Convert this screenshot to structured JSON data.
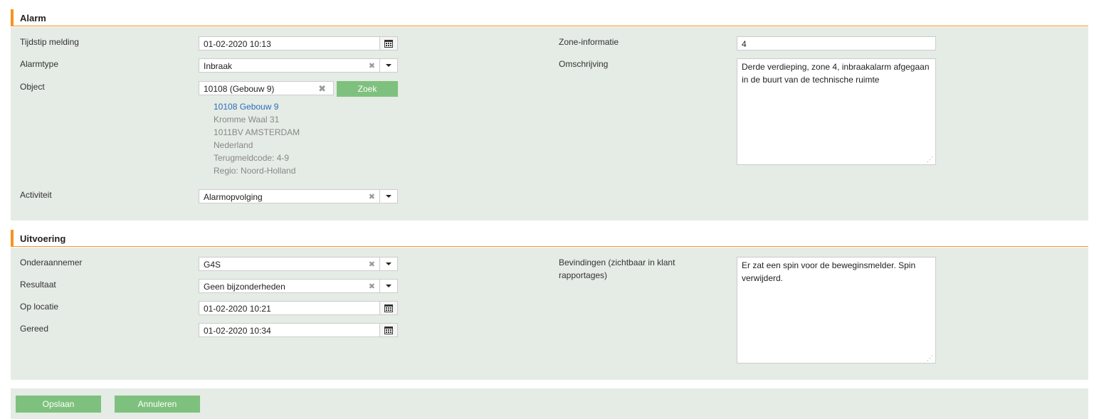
{
  "alarm": {
    "title": "Alarm",
    "tijdstip_label": "Tijdstip melding",
    "tijdstip_value": "01-02-2020 10:13",
    "alarmtype_label": "Alarmtype",
    "alarmtype_value": "Inbraak",
    "object_label": "Object",
    "object_value": "10108 (Gebouw 9)",
    "zoek_label": "Zoek",
    "object_info": {
      "link": "10108 Gebouw 9",
      "street": "Kromme Waal 31",
      "city": "1011BV AMSTERDAM",
      "country": "Nederland",
      "code": "Terugmeldcode: 4-9",
      "region": "Regio: Noord-Holland"
    },
    "activiteit_label": "Activiteit",
    "activiteit_value": "Alarmopvolging",
    "zone_label": "Zone-informatie",
    "zone_value": "4",
    "omschrijving_label": "Omschrijving",
    "omschrijving_value": "Derde verdieping, zone 4, inbraakalarm afgegaan in de buurt van de technische ruimte"
  },
  "uitvoering": {
    "title": "Uitvoering",
    "onderaannemer_label": "Onderaannemer",
    "onderaannemer_value": "G4S",
    "resultaat_label": "Resultaat",
    "resultaat_value": "Geen bijzonderheden",
    "oplocatie_label": "Op locatie",
    "oplocatie_value": "01-02-2020 10:21",
    "gereed_label": "Gereed",
    "gereed_value": "01-02-2020 10:34",
    "bevindingen_label": "Bevindingen (zichtbaar in klant rapportages)",
    "bevindingen_value": "Er zat een spin voor de beweginsmelder. Spin verwijderd."
  },
  "footer": {
    "save_label": "Opslaan",
    "cancel_label": "Annuleren"
  },
  "icons": {
    "calendar": "calendar-icon",
    "clear": "clear-icon",
    "dropdown": "chevron-down-icon",
    "resize": "resize-grip-icon"
  },
  "colors": {
    "accent": "#f7931e",
    "panel_bg": "#e5ebe5",
    "button": "#7ec17e",
    "link": "#2a6ebb"
  }
}
